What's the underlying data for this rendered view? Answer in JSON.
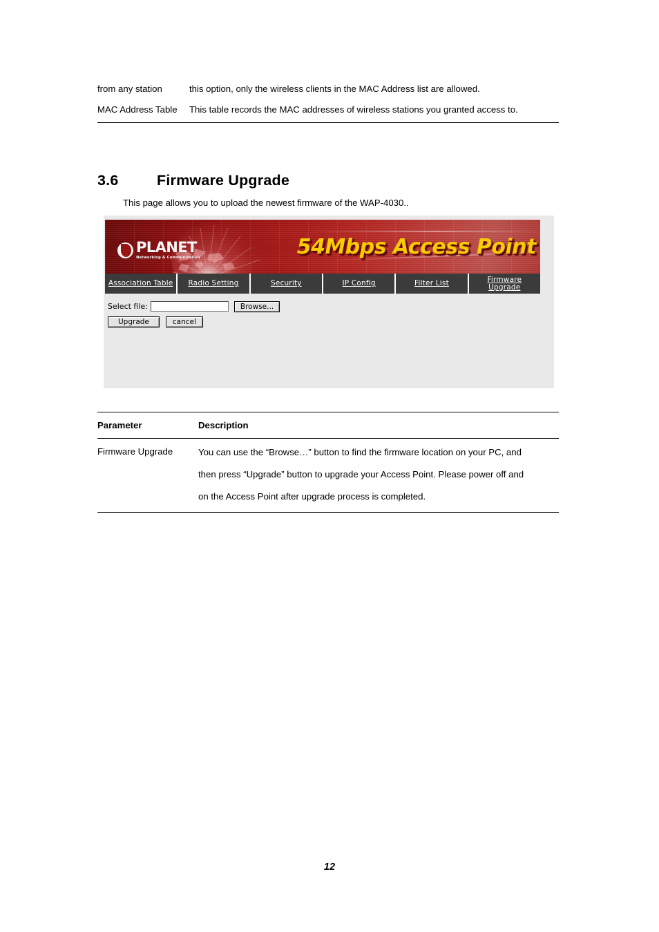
{
  "document": {
    "continued_rows": [
      {
        "label": "from any station",
        "text": "this option, only the wireless clients in the MAC Address list are allowed."
      },
      {
        "label": "MAC Address Table",
        "text": "This table records the MAC addresses of wireless stations you granted access to."
      }
    ],
    "section": {
      "number": "3.6",
      "title": "Firmware Upgrade",
      "intro": "This page allows you to upload the newest firmware of the WAP-4030.."
    },
    "page_number": "12"
  },
  "screenshot": {
    "banner": {
      "logo_name": "PLANET",
      "logo_tagline": "Networking & Communication",
      "logo_mark_icon": "planet-globe-icon",
      "title": "54Mbps Access Point",
      "title_color": "#ffd400",
      "background_color": "#a81a18"
    },
    "nav_tabs": [
      {
        "label": "Association Table",
        "active": false
      },
      {
        "label": "Radio Setting",
        "active": false
      },
      {
        "label": "Security",
        "active": false
      },
      {
        "label": "IP Config",
        "active": false
      },
      {
        "label": "Filter List",
        "active": false
      },
      {
        "label_line1": "Firmware",
        "label_line2": "Upgrade",
        "active": true
      }
    ],
    "form": {
      "select_file_label": "Select file:",
      "select_file_value": "",
      "select_file_placeholder": "",
      "browse_button": "Browse...",
      "upgrade_button": "Upgrade",
      "cancel_button": "cancel"
    }
  },
  "param_table": {
    "headers": {
      "parameter": "Parameter",
      "description": "Description"
    },
    "rows": [
      {
        "parameter": "Firmware Upgrade",
        "description_lines": [
          "You can use the “Browse…” button to find the firmware location on your PC, and",
          "then press “Upgrade” button to upgrade your Access Point. Please power off and",
          "on the Access Point after upgrade process is completed."
        ]
      }
    ]
  }
}
